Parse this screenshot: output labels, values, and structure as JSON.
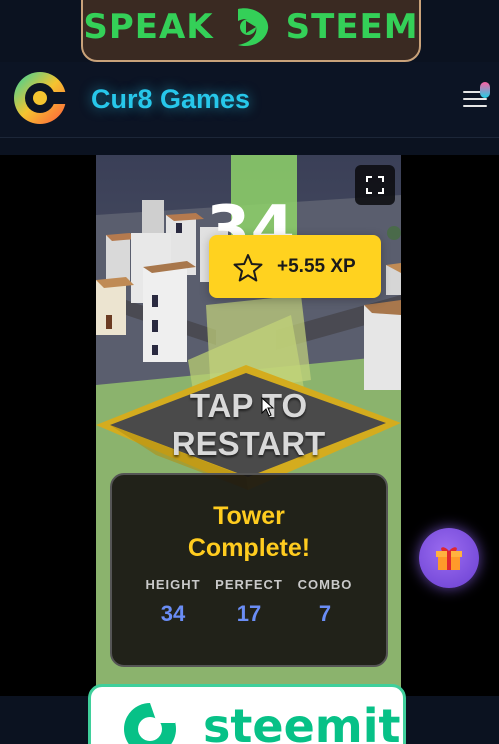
{
  "banner": {
    "left_word": "SPEAK",
    "right_word": "STEEM",
    "color": "#34d058"
  },
  "header": {
    "site_title": "Cur8 Games",
    "logo_icon": "cur8-logo-icon",
    "menu_icon": "hamburger-menu-icon",
    "title_color": "#27c7ea"
  },
  "game": {
    "score": "34",
    "xp_reward": "+5.55 XP",
    "restart_line1": "TAP TO",
    "restart_line2": "RESTART",
    "fullscreen_icon": "fullscreen-icon",
    "result": {
      "title_line1": "Tower",
      "title_line2": "Complete!",
      "stats": [
        {
          "label": "HEIGHT",
          "value": "34"
        },
        {
          "label": "PERFECT",
          "value": "17"
        },
        {
          "label": "COMBO",
          "value": "7"
        }
      ]
    }
  },
  "gift_icon": "gift-icon",
  "footer_card": {
    "word": "steemit",
    "color": "#07c187"
  }
}
